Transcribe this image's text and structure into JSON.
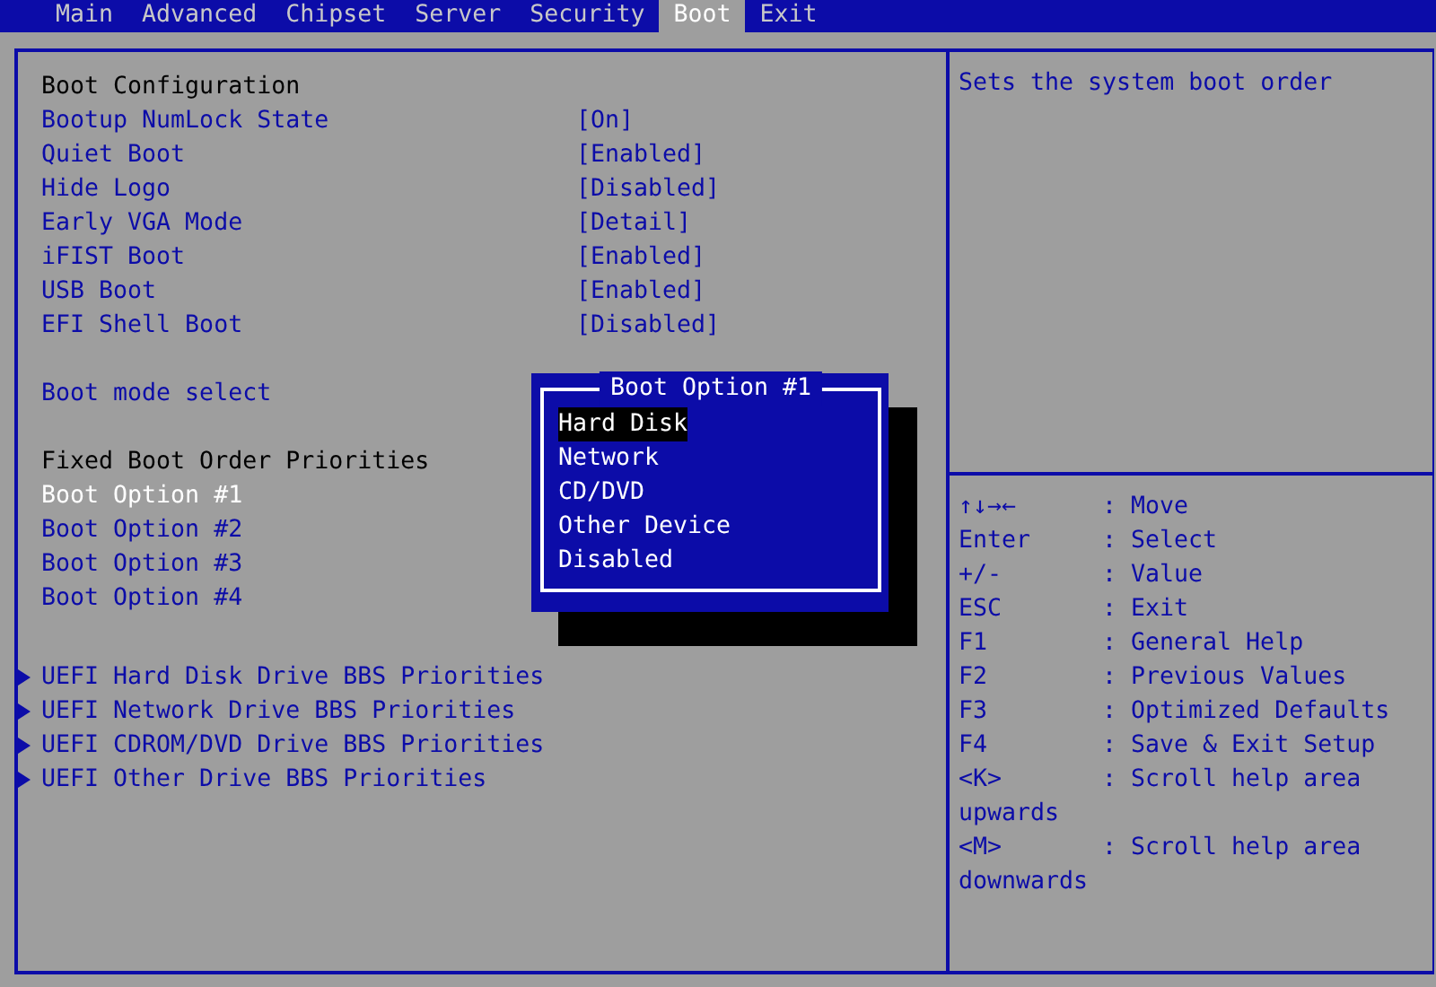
{
  "tabs": [
    {
      "label": "Main",
      "selected": false
    },
    {
      "label": "Advanced",
      "selected": false
    },
    {
      "label": "Chipset",
      "selected": false
    },
    {
      "label": "Server",
      "selected": false
    },
    {
      "label": "Security",
      "selected": false
    },
    {
      "label": "Boot",
      "selected": true
    },
    {
      "label": "Exit",
      "selected": false
    }
  ],
  "menu_groups": [
    {
      "items": [
        {
          "kind": "heading",
          "label": "Boot Configuration",
          "selected": false
        },
        {
          "kind": "setting",
          "label": "Bootup NumLock State",
          "value": "[On]",
          "selected": false
        },
        {
          "kind": "setting",
          "label": "Quiet Boot",
          "value": "[Enabled]",
          "selected": false
        },
        {
          "kind": "setting",
          "label": "Hide Logo",
          "value": "[Disabled]",
          "selected": false
        },
        {
          "kind": "setting",
          "label": "Early VGA Mode",
          "value": "[Detail]",
          "selected": false
        },
        {
          "kind": "setting",
          "label": "iFIST Boot",
          "value": "[Enabled]",
          "selected": false
        },
        {
          "kind": "setting",
          "label": "USB Boot",
          "value": "[Enabled]",
          "selected": false
        },
        {
          "kind": "setting",
          "label": "EFI Shell Boot",
          "value": "[Disabled]",
          "selected": false
        }
      ]
    },
    {
      "items": [
        {
          "kind": "setting",
          "label": "Boot mode select",
          "selected": false
        }
      ]
    },
    {
      "items": [
        {
          "kind": "heading",
          "label": "Fixed Boot Order Priorities",
          "selected": false
        },
        {
          "kind": "setting",
          "label": "Boot Option #1",
          "selected": true
        },
        {
          "kind": "setting",
          "label": "Boot Option #2",
          "selected": false
        },
        {
          "kind": "setting",
          "label": "Boot Option #3",
          "selected": false
        },
        {
          "kind": "setting",
          "label": "Boot Option #4",
          "selected": false
        }
      ]
    },
    {
      "items": [
        {
          "kind": "submenu",
          "label": "UEFI Hard Disk Drive BBS Priorities",
          "selected": false
        },
        {
          "kind": "submenu",
          "label": "UEFI Network Drive BBS Priorities",
          "selected": false
        },
        {
          "kind": "submenu",
          "label": "UEFI CDROM/DVD Drive BBS Priorities",
          "selected": false
        },
        {
          "kind": "submenu",
          "label": "UEFI Other Drive BBS Priorities",
          "selected": false
        }
      ]
    }
  ],
  "help_text": "Sets the system boot order",
  "key_help": [
    {
      "key": "↑↓→←",
      "action": ": Move"
    },
    {
      "key": "Enter",
      "action": ": Select"
    },
    {
      "key": "+/-",
      "action": ": Value"
    },
    {
      "key": "ESC",
      "action": ": Exit"
    },
    {
      "key": "F1",
      "action": ": General Help"
    },
    {
      "key": "F2",
      "action": ": Previous Values"
    },
    {
      "key": "F3",
      "action": ": Optimized Defaults"
    },
    {
      "key": "F4",
      "action": ": Save & Exit Setup"
    },
    {
      "key": "<K>",
      "action": ": Scroll help area",
      "continuation": "upwards"
    },
    {
      "key": "<M>",
      "action": ": Scroll help area",
      "continuation": "downwards"
    }
  ],
  "popup": {
    "title": "Boot Option #1",
    "options": [
      {
        "label": "Hard Disk",
        "selected": true
      },
      {
        "label": "Network",
        "selected": false
      },
      {
        "label": "CD/DVD",
        "selected": false
      },
      {
        "label": "Other Device",
        "selected": false
      },
      {
        "label": "Disabled",
        "selected": false
      }
    ]
  }
}
